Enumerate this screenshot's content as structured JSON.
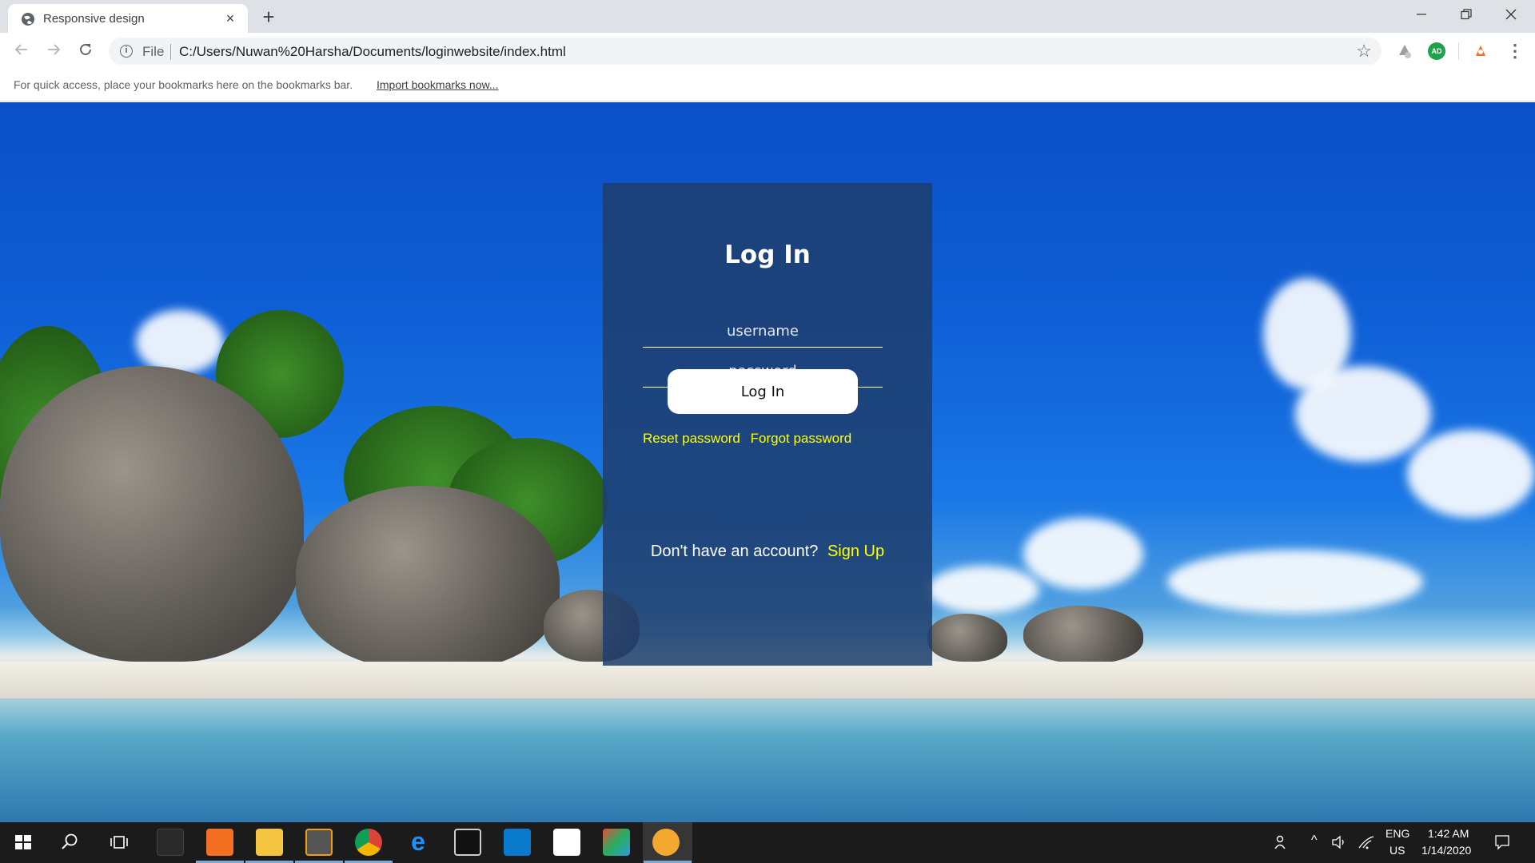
{
  "browser": {
    "tab_title": "Responsive design",
    "close_glyph": "×",
    "new_tab_glyph": "+",
    "url_scheme": "File",
    "url": "C:/Users/Nuwan%20Harsha/Documents/loginwebsite/index.html",
    "bookmarks_message": "For quick access, place your bookmarks here on the bookmarks bar.",
    "bookmarks_link": "Import bookmarks now...",
    "ext_badge": "AD"
  },
  "login": {
    "title": "Log In",
    "username_placeholder": "username",
    "password_placeholder": "password",
    "button_label": "Log In",
    "reset_link": "Reset password",
    "forgot_link": "Forgot password",
    "no_account_text": "Don't have an account?",
    "signup_link": "Sign Up"
  },
  "taskbar": {
    "language": "ENG",
    "region": "US",
    "time": "1:42 AM",
    "date": "1/14/2020"
  },
  "colors": {
    "link_yellow": "#ffff00",
    "panel_bg": "#1e3e6e"
  }
}
